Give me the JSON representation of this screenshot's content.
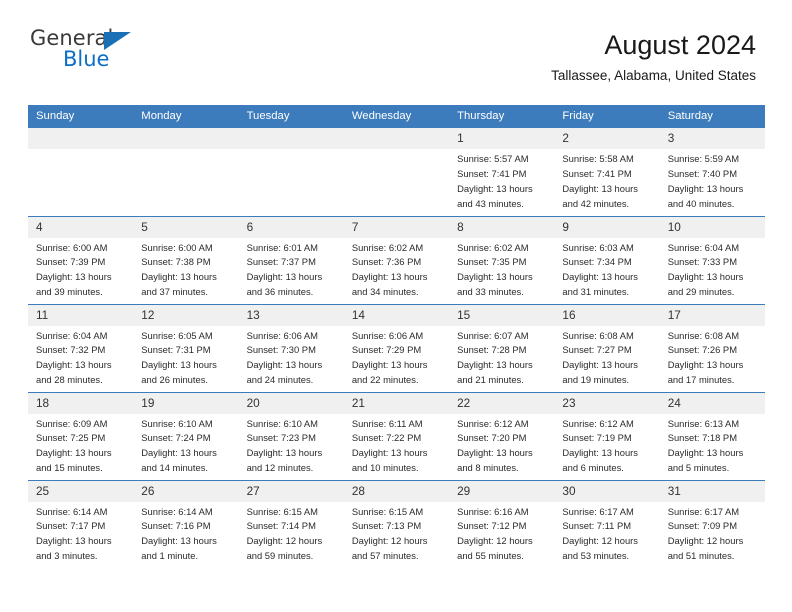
{
  "logo": {
    "word_one": "General",
    "word_two": "Blue",
    "flag_icon": "blue-triangle-flag-icon",
    "accent_color": "#1b6fb5",
    "blue_text_color": "#0b6fc4"
  },
  "header": {
    "title": "August 2024",
    "subtitle": "Tallassee, Alabama, United States",
    "header_bg_color": "#3d7cbc",
    "daynum_bg_color": "#f0f0f0"
  },
  "weekdays": [
    "Sunday",
    "Monday",
    "Tuesday",
    "Wednesday",
    "Thursday",
    "Friday",
    "Saturday"
  ],
  "weeks": [
    [
      {
        "day": "",
        "lines": []
      },
      {
        "day": "",
        "lines": []
      },
      {
        "day": "",
        "lines": []
      },
      {
        "day": "",
        "lines": []
      },
      {
        "day": "1",
        "lines": [
          "Sunrise: 5:57 AM",
          "Sunset: 7:41 PM",
          "Daylight: 13 hours",
          "and 43 minutes."
        ]
      },
      {
        "day": "2",
        "lines": [
          "Sunrise: 5:58 AM",
          "Sunset: 7:41 PM",
          "Daylight: 13 hours",
          "and 42 minutes."
        ]
      },
      {
        "day": "3",
        "lines": [
          "Sunrise: 5:59 AM",
          "Sunset: 7:40 PM",
          "Daylight: 13 hours",
          "and 40 minutes."
        ]
      }
    ],
    [
      {
        "day": "4",
        "lines": [
          "Sunrise: 6:00 AM",
          "Sunset: 7:39 PM",
          "Daylight: 13 hours",
          "and 39 minutes."
        ]
      },
      {
        "day": "5",
        "lines": [
          "Sunrise: 6:00 AM",
          "Sunset: 7:38 PM",
          "Daylight: 13 hours",
          "and 37 minutes."
        ]
      },
      {
        "day": "6",
        "lines": [
          "Sunrise: 6:01 AM",
          "Sunset: 7:37 PM",
          "Daylight: 13 hours",
          "and 36 minutes."
        ]
      },
      {
        "day": "7",
        "lines": [
          "Sunrise: 6:02 AM",
          "Sunset: 7:36 PM",
          "Daylight: 13 hours",
          "and 34 minutes."
        ]
      },
      {
        "day": "8",
        "lines": [
          "Sunrise: 6:02 AM",
          "Sunset: 7:35 PM",
          "Daylight: 13 hours",
          "and 33 minutes."
        ]
      },
      {
        "day": "9",
        "lines": [
          "Sunrise: 6:03 AM",
          "Sunset: 7:34 PM",
          "Daylight: 13 hours",
          "and 31 minutes."
        ]
      },
      {
        "day": "10",
        "lines": [
          "Sunrise: 6:04 AM",
          "Sunset: 7:33 PM",
          "Daylight: 13 hours",
          "and 29 minutes."
        ]
      }
    ],
    [
      {
        "day": "11",
        "lines": [
          "Sunrise: 6:04 AM",
          "Sunset: 7:32 PM",
          "Daylight: 13 hours",
          "and 28 minutes."
        ]
      },
      {
        "day": "12",
        "lines": [
          "Sunrise: 6:05 AM",
          "Sunset: 7:31 PM",
          "Daylight: 13 hours",
          "and 26 minutes."
        ]
      },
      {
        "day": "13",
        "lines": [
          "Sunrise: 6:06 AM",
          "Sunset: 7:30 PM",
          "Daylight: 13 hours",
          "and 24 minutes."
        ]
      },
      {
        "day": "14",
        "lines": [
          "Sunrise: 6:06 AM",
          "Sunset: 7:29 PM",
          "Daylight: 13 hours",
          "and 22 minutes."
        ]
      },
      {
        "day": "15",
        "lines": [
          "Sunrise: 6:07 AM",
          "Sunset: 7:28 PM",
          "Daylight: 13 hours",
          "and 21 minutes."
        ]
      },
      {
        "day": "16",
        "lines": [
          "Sunrise: 6:08 AM",
          "Sunset: 7:27 PM",
          "Daylight: 13 hours",
          "and 19 minutes."
        ]
      },
      {
        "day": "17",
        "lines": [
          "Sunrise: 6:08 AM",
          "Sunset: 7:26 PM",
          "Daylight: 13 hours",
          "and 17 minutes."
        ]
      }
    ],
    [
      {
        "day": "18",
        "lines": [
          "Sunrise: 6:09 AM",
          "Sunset: 7:25 PM",
          "Daylight: 13 hours",
          "and 15 minutes."
        ]
      },
      {
        "day": "19",
        "lines": [
          "Sunrise: 6:10 AM",
          "Sunset: 7:24 PM",
          "Daylight: 13 hours",
          "and 14 minutes."
        ]
      },
      {
        "day": "20",
        "lines": [
          "Sunrise: 6:10 AM",
          "Sunset: 7:23 PM",
          "Daylight: 13 hours",
          "and 12 minutes."
        ]
      },
      {
        "day": "21",
        "lines": [
          "Sunrise: 6:11 AM",
          "Sunset: 7:22 PM",
          "Daylight: 13 hours",
          "and 10 minutes."
        ]
      },
      {
        "day": "22",
        "lines": [
          "Sunrise: 6:12 AM",
          "Sunset: 7:20 PM",
          "Daylight: 13 hours",
          "and 8 minutes."
        ]
      },
      {
        "day": "23",
        "lines": [
          "Sunrise: 6:12 AM",
          "Sunset: 7:19 PM",
          "Daylight: 13 hours",
          "and 6 minutes."
        ]
      },
      {
        "day": "24",
        "lines": [
          "Sunrise: 6:13 AM",
          "Sunset: 7:18 PM",
          "Daylight: 13 hours",
          "and 5 minutes."
        ]
      }
    ],
    [
      {
        "day": "25",
        "lines": [
          "Sunrise: 6:14 AM",
          "Sunset: 7:17 PM",
          "Daylight: 13 hours",
          "and 3 minutes."
        ]
      },
      {
        "day": "26",
        "lines": [
          "Sunrise: 6:14 AM",
          "Sunset: 7:16 PM",
          "Daylight: 13 hours",
          "and 1 minute."
        ]
      },
      {
        "day": "27",
        "lines": [
          "Sunrise: 6:15 AM",
          "Sunset: 7:14 PM",
          "Daylight: 12 hours",
          "and 59 minutes."
        ]
      },
      {
        "day": "28",
        "lines": [
          "Sunrise: 6:15 AM",
          "Sunset: 7:13 PM",
          "Daylight: 12 hours",
          "and 57 minutes."
        ]
      },
      {
        "day": "29",
        "lines": [
          "Sunrise: 6:16 AM",
          "Sunset: 7:12 PM",
          "Daylight: 12 hours",
          "and 55 minutes."
        ]
      },
      {
        "day": "30",
        "lines": [
          "Sunrise: 6:17 AM",
          "Sunset: 7:11 PM",
          "Daylight: 12 hours",
          "and 53 minutes."
        ]
      },
      {
        "day": "31",
        "lines": [
          "Sunrise: 6:17 AM",
          "Sunset: 7:09 PM",
          "Daylight: 12 hours",
          "and 51 minutes."
        ]
      }
    ]
  ]
}
